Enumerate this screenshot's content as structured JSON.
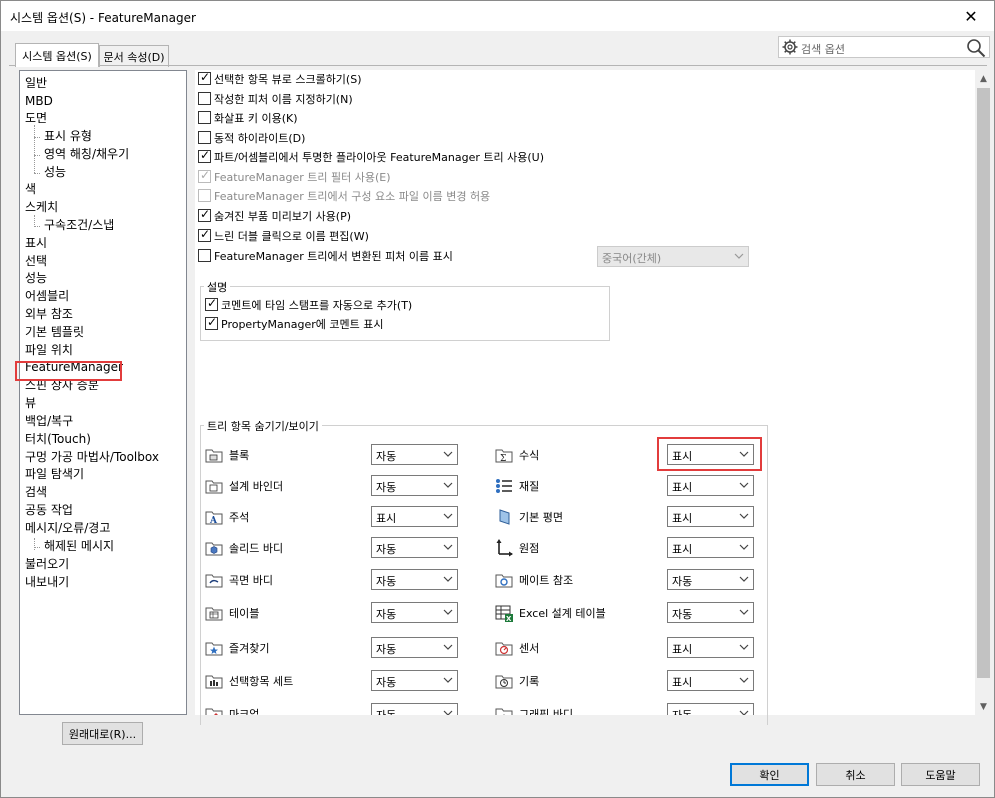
{
  "window": {
    "title": "시스템 옵션(S) - FeatureManager",
    "close_symbol": "✕"
  },
  "tabs": [
    {
      "label": "시스템 옵션(S)",
      "active": true
    },
    {
      "label": "문서 속성(D)",
      "active": false
    }
  ],
  "search": {
    "placeholder": "검색 옵션",
    "gear_icon": "gear-icon",
    "search_icon": "search-icon"
  },
  "tree": {
    "items": [
      {
        "label": "일반",
        "child": false
      },
      {
        "label": "MBD",
        "child": false
      },
      {
        "label": "도면",
        "child": false
      },
      {
        "label": "표시 유형",
        "child": true
      },
      {
        "label": "영역 해칭/채우기",
        "child": true
      },
      {
        "label": "성능",
        "child": true
      },
      {
        "label": "색",
        "child": false
      },
      {
        "label": "스케치",
        "child": false
      },
      {
        "label": "구속조건/스냅",
        "child": true
      },
      {
        "label": "표시",
        "child": false
      },
      {
        "label": "선택",
        "child": false
      },
      {
        "label": "성능",
        "child": false
      },
      {
        "label": "어셈블리",
        "child": false
      },
      {
        "label": "외부 참조",
        "child": false
      },
      {
        "label": "기본 템플릿",
        "child": false
      },
      {
        "label": "파일 위치",
        "child": false
      },
      {
        "label": "FeatureManager",
        "child": false,
        "selected": true
      },
      {
        "label": "스핀 상자 증분",
        "child": false
      },
      {
        "label": "뷰",
        "child": false
      },
      {
        "label": "백업/복구",
        "child": false
      },
      {
        "label": "터치(Touch)",
        "child": false
      },
      {
        "label": "구멍 가공 마법사/Toolbox",
        "child": false
      },
      {
        "label": "파일 탐색기",
        "child": false
      },
      {
        "label": "검색",
        "child": false
      },
      {
        "label": "공동 작업",
        "child": false
      },
      {
        "label": "메시지/오류/경고",
        "child": false
      },
      {
        "label": "해제된 메시지",
        "child": true
      },
      {
        "label": "불러오기",
        "child": false
      },
      {
        "label": "내보내기",
        "child": false
      }
    ]
  },
  "options": [
    {
      "label": "선택한 항목 뷰로 스크롤하기(S)",
      "checked": true,
      "disabled": false
    },
    {
      "label": "작성한 피처 이름 지정하기(N)",
      "checked": false,
      "disabled": false
    },
    {
      "label": "화살표 키 이용(K)",
      "checked": false,
      "disabled": false
    },
    {
      "label": "동적 하이라이트(D)",
      "checked": false,
      "disabled": false
    },
    {
      "label": "파트/어셈블리에서 투명한 플라이아웃 FeatureManager 트리 사용(U)",
      "checked": true,
      "disabled": false
    },
    {
      "label": "FeatureManager 트리 필터 사용(E)",
      "checked": true,
      "disabled": true
    },
    {
      "label": "FeatureManager 트리에서 구성 요소 파일 이름 변경 허용",
      "checked": false,
      "disabled": true
    },
    {
      "label": "숨겨진 부품 미리보기 사용(P)",
      "checked": true,
      "disabled": false
    },
    {
      "label": "느린 더블 클릭으로 이름 편집(W)",
      "checked": true,
      "disabled": false
    },
    {
      "label": "FeatureManager 트리에서 변환된 피처 이름 표시",
      "checked": false,
      "disabled": false
    }
  ],
  "language_select": {
    "value": "중국어(간체)"
  },
  "description_group": {
    "title": "설명",
    "items": [
      {
        "label": "코멘트에 타임 스탬프를 자동으로 추가(T)",
        "checked": true
      },
      {
        "label": "PropertyManager에 코멘트 표시",
        "checked": true
      }
    ]
  },
  "tree_items_group": {
    "title": "트리 항목 숨기기/보이기",
    "left": [
      {
        "label": "블록",
        "value": "자동",
        "icon": "block-folder-icon"
      },
      {
        "label": "설계 바인더",
        "value": "자동",
        "icon": "design-binder-folder-icon"
      },
      {
        "label": "주석",
        "value": "표시",
        "icon": "annotations-folder-icon"
      },
      {
        "label": "솔리드 바디",
        "value": "자동",
        "icon": "solid-bodies-folder-icon"
      },
      {
        "label": "곡면 바디",
        "value": "자동",
        "icon": "surface-bodies-folder-icon"
      },
      {
        "label": "테이블",
        "value": "자동",
        "icon": "tables-folder-icon"
      },
      {
        "label": "즐겨찾기",
        "value": "자동",
        "icon": "favorites-folder-icon"
      },
      {
        "label": "선택항목 세트",
        "value": "자동",
        "icon": "selection-sets-folder-icon"
      },
      {
        "label": "마크업",
        "value": "자동",
        "icon": "markups-folder-icon"
      }
    ],
    "right": [
      {
        "label": "수식",
        "value": "표시",
        "icon": "equations-icon"
      },
      {
        "label": "재질",
        "value": "표시",
        "icon": "material-icon"
      },
      {
        "label": "기본 평면",
        "value": "표시",
        "icon": "default-planes-icon"
      },
      {
        "label": "원점",
        "value": "표시",
        "icon": "origin-icon"
      },
      {
        "label": "메이트 참조",
        "value": "자동",
        "icon": "mate-references-icon"
      },
      {
        "label": "Excel 설계 테이블",
        "value": "자동",
        "icon": "excel-design-table-icon"
      },
      {
        "label": "센서",
        "value": "표시",
        "icon": "sensors-icon"
      },
      {
        "label": "기록",
        "value": "표시",
        "icon": "history-icon"
      },
      {
        "label": "그래픽 바디",
        "value": "자동",
        "icon": "graphic-bodies-icon"
      }
    ]
  },
  "buttons": {
    "reset": "원래대로(R)...",
    "ok": "확인",
    "cancel": "취소",
    "help": "도움말"
  }
}
